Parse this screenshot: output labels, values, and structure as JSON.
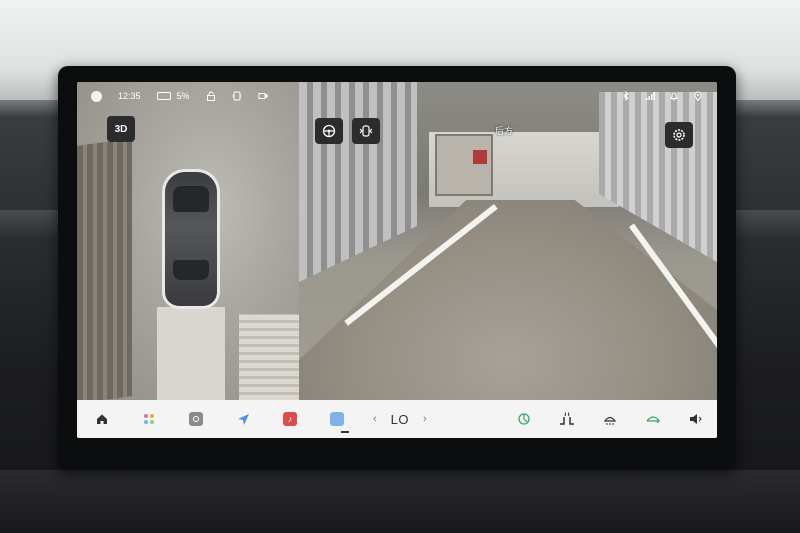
{
  "status_bar": {
    "time": "12:35",
    "battery_percent": "5%",
    "icons_left": [
      "avatar-icon",
      "battery-icon",
      "lock-icon",
      "sentry-icon",
      "dashcam-icon"
    ],
    "icons_right": [
      "bluetooth-icon",
      "signal-icon",
      "bell-icon",
      "location-icon"
    ]
  },
  "top_view": {
    "mode_button": "3D"
  },
  "rear_camera": {
    "label": "后方",
    "buttons": [
      "steering-wheel-icon",
      "view-switch-icon",
      "settings-icon"
    ]
  },
  "dock": {
    "left_items": [
      "home-icon",
      "apps-icon",
      "settings-icon",
      "navigation-icon",
      "music-icon",
      "camera-icon"
    ],
    "climate": {
      "temperature": "LO",
      "left_chevron": "‹",
      "right_chevron": "›"
    },
    "right_items": [
      "fan-icon",
      "seat-heat-icon",
      "defrost-icon",
      "recirculation-icon",
      "volume-icon"
    ]
  },
  "colors": {
    "dock_bg": "#f4f4f4",
    "button_bg": "#2b2c2e",
    "music_app": "#e04a4a",
    "camera_app": "#7fb2e8",
    "fan_icon": "#3aa86b"
  }
}
